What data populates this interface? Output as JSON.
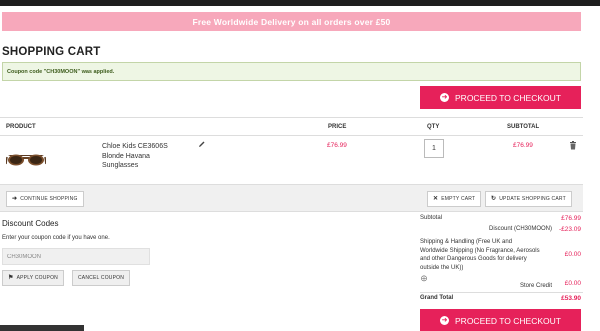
{
  "banner": {
    "text": "Free Worldwide Delivery on all orders over £50"
  },
  "page": {
    "title": "SHOPPING CART"
  },
  "notice": {
    "text": "Coupon code \"CH30MOON\" was applied."
  },
  "checkout": {
    "label": "PROCEED TO CHECKOUT"
  },
  "table": {
    "headers": {
      "product": "PRODUCT",
      "price": "PRICE",
      "qty": "QTY",
      "subtotal": "SUBTOTAL"
    }
  },
  "item": {
    "name_lines": [
      "Chloe Kids CE3606S",
      "Blonde Havana",
      "Sunglasses"
    ],
    "price": "£76.99",
    "qty": "1",
    "subtotal": "£76.99",
    "icons": {
      "edit": "pencil-icon",
      "delete": "trash-icon"
    }
  },
  "actions": {
    "continue": "CONTINUE SHOPPING",
    "empty": "EMPTY CART",
    "update": "UPDATE SHOPPING CART"
  },
  "discount": {
    "title": "Discount Codes",
    "help": "Enter your coupon code if you have one.",
    "code_value": "CH30MOON",
    "apply": "APPLY COUPON",
    "cancel": "CANCEL COUPON"
  },
  "totals": {
    "subtotal_label": "Subtotal",
    "subtotal_value": "£76.99",
    "discount_label": "Discount (CH30MOON)",
    "discount_value": "-£23.09",
    "shipping_lines": [
      "Shipping & Handling (Free UK and",
      "Worldwide Shipping (No Fragrance, Aerosols",
      "and other Dangerous Goods for delivery",
      "outside the UK))"
    ],
    "shipping_value": "£0.00",
    "store_credit_label": "Store Credit",
    "store_credit_value": "£0.00",
    "grand_total_label": "Grand Total",
    "grand_total_value": "£53.90"
  },
  "colors": {
    "accent": "#e6215a",
    "banner": "#f7a8bb",
    "notice_bg": "#eef6e4"
  }
}
